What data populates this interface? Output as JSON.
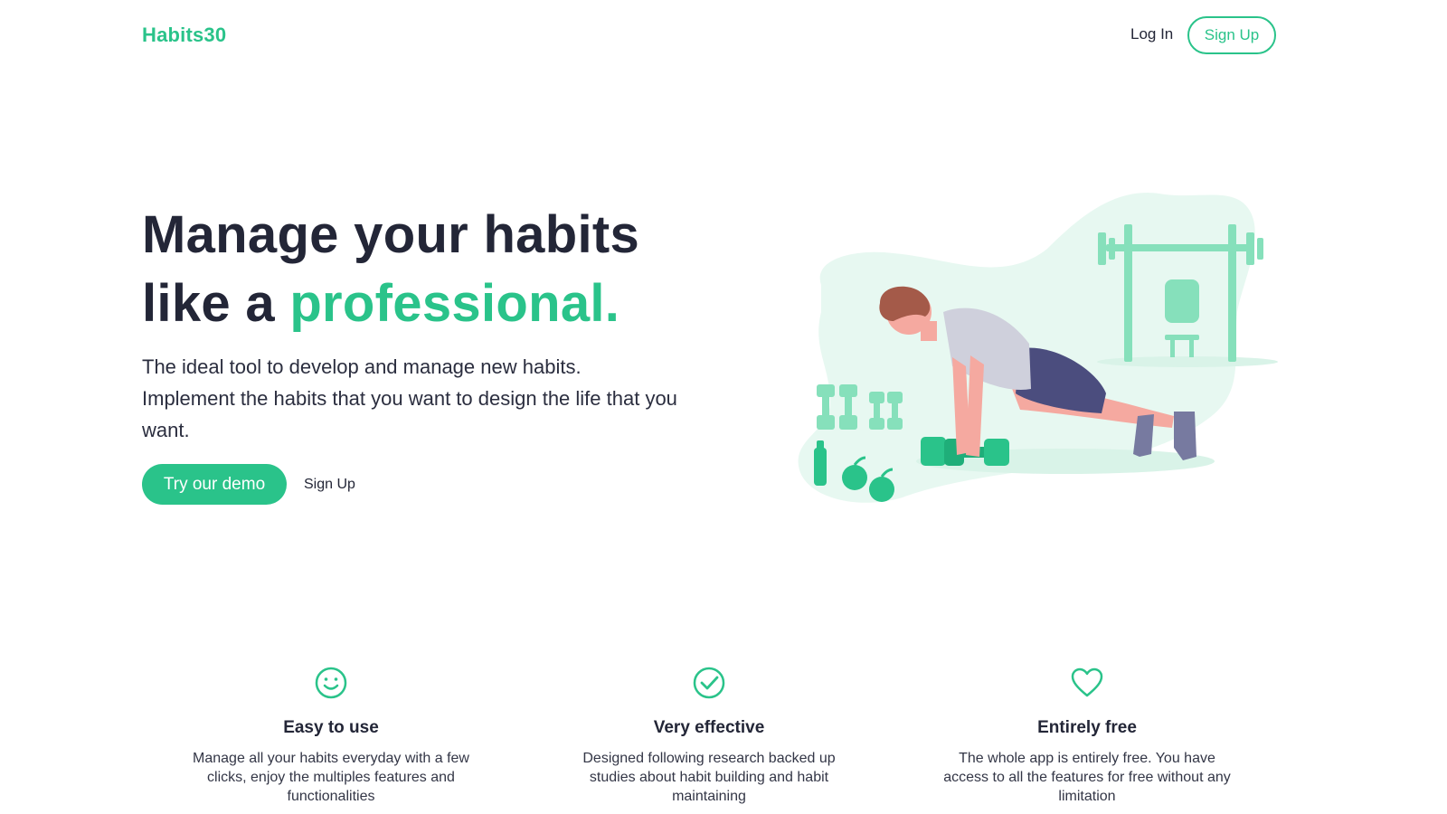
{
  "nav": {
    "logo": "Habits30",
    "login": "Log In",
    "signup": "Sign Up"
  },
  "hero": {
    "title_line1": "Manage your habits",
    "title_line2_prefix": "like a ",
    "title_line2_accent": "professional.",
    "subtitle_line1": "The ideal tool to develop and manage new habits.",
    "subtitle_line2": "Implement the habits that you want to design the life that you want.",
    "cta_primary": "Try our demo",
    "cta_secondary": "Sign Up"
  },
  "features": [
    {
      "icon": "smiley-icon",
      "title": "Easy to use",
      "text": "Manage all your habits everyday with a few clicks, enjoy the multiples features and functionalities"
    },
    {
      "icon": "check-circle-icon",
      "title": "Very effective",
      "text": "Designed following research backed up studies about habit building and habit maintaining"
    },
    {
      "icon": "heart-icon",
      "title": "Entirely free",
      "text": "The whole app is entirely free. You have access to all the features for free without any limitation"
    }
  ],
  "colors": {
    "accent": "#2ac38a",
    "text_dark": "#232637",
    "blob": "#e7f8f1"
  }
}
